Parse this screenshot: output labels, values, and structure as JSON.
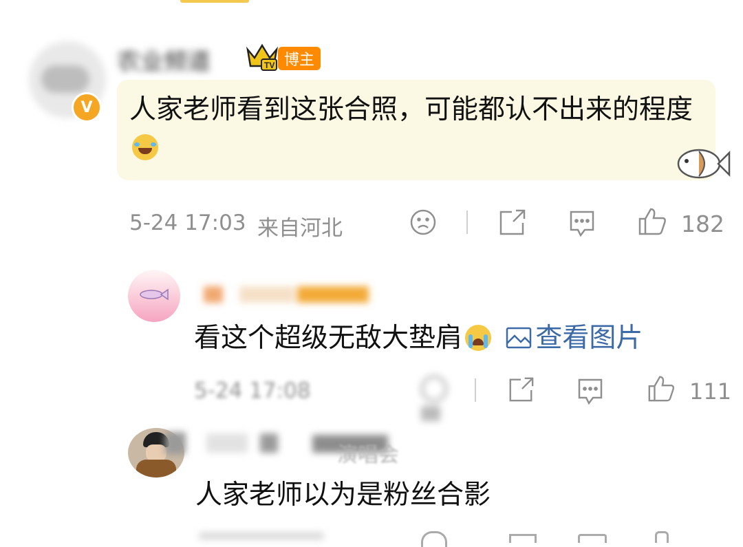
{
  "main_comment": {
    "username": "农业频道",
    "badge": "博主",
    "verified_badge": "V",
    "text": "人家老师看到这张合照，可能都认不出来的程度",
    "emoji": "laughing-crying",
    "time": "5-24 17:03",
    "location": "来自河北",
    "likes": "182"
  },
  "reply1": {
    "text": "看这个超级无敌大垫肩",
    "emoji": "crying",
    "view_image_label": "查看图片",
    "time": "5-24 17:08",
    "likes": "111"
  },
  "reply2": {
    "username": "演唱会",
    "text": "人家老师以为是粉丝合影"
  },
  "colors": {
    "bubble": "#fbf8e4",
    "meta_gray": "#8f8f8f",
    "badge_orange": "#ff8a00",
    "link_blue": "#3c6aa7"
  }
}
